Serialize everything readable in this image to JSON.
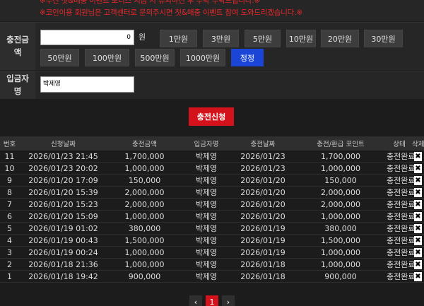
{
  "notice": {
    "line1": "※무신 첫&매충 이벤트 보너스 지급 시 유의하신 후 수락 부탁드립니다.※",
    "line2": "※코인이용 회원님은 고객센터로 문의주시면 첫&매충 이벤트 참여 도와드리겠습니다.※"
  },
  "amount": {
    "label": "충전금액",
    "input_value": "0",
    "currency": "원",
    "buttons": [
      "1만원",
      "3만원",
      "5만원",
      "10만원",
      "20만원",
      "30만원",
      "50만원",
      "100만원",
      "500만원",
      "1000만원"
    ],
    "correct_label": "정정"
  },
  "depositor": {
    "label": "입금자명",
    "input_value": "박제영"
  },
  "submit_label": "충전신청",
  "table": {
    "headers": [
      "번호",
      "신청날짜",
      "충전금액",
      "입금자명",
      "충전날짜",
      "충전/환급 포인트",
      "상태",
      "삭제"
    ],
    "rows": [
      [
        "11",
        "2026/01/23 21:45",
        "1,700,000",
        "박제영",
        "2026/01/23",
        "1,700,000",
        "충전완료"
      ],
      [
        "10",
        "2026/01/23 20:02",
        "1,000,000",
        "박제영",
        "2026/01/23",
        "1,000,000",
        "충전완료"
      ],
      [
        "9",
        "2026/01/20 17:09",
        "150,000",
        "박제영",
        "2026/01/20",
        "150,000",
        "충전완료"
      ],
      [
        "8",
        "2026/01/20 15:39",
        "2,000,000",
        "박제영",
        "2026/01/20",
        "2,000,000",
        "충전완료"
      ],
      [
        "7",
        "2026/01/20 15:23",
        "2,000,000",
        "박제영",
        "2026/01/20",
        "2,000,000",
        "충전완료"
      ],
      [
        "6",
        "2026/01/20 15:09",
        "1,000,000",
        "박제영",
        "2026/01/20",
        "1,000,000",
        "충전완료"
      ],
      [
        "5",
        "2026/01/19 01:02",
        "380,000",
        "박제영",
        "2026/01/19",
        "380,000",
        "충전완료"
      ],
      [
        "4",
        "2026/01/19 00:43",
        "1,500,000",
        "박제영",
        "2026/01/19",
        "1,500,000",
        "충전완료"
      ],
      [
        "3",
        "2026/01/19 00:24",
        "1,000,000",
        "박제영",
        "2026/01/19",
        "1,000,000",
        "충전완료"
      ],
      [
        "2",
        "2026/01/18 21:36",
        "1,000,000",
        "박제영",
        "2026/01/18",
        "1,000,000",
        "충전완료"
      ],
      [
        "1",
        "2026/01/18 19:42",
        "900,000",
        "박제영",
        "2026/01/18",
        "900,000",
        "충전완료"
      ]
    ],
    "delete_glyph": "✖"
  },
  "pager": {
    "prev": "‹",
    "current": "1",
    "next": "›"
  }
}
